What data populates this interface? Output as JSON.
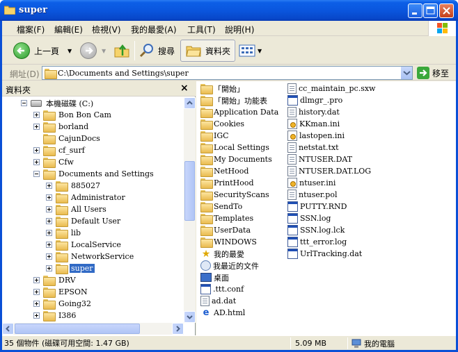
{
  "window": {
    "title": "super"
  },
  "menu": {
    "items": [
      "檔案(F)",
      "編輯(E)",
      "檢視(V)",
      "我的最愛(A)",
      "工具(T)",
      "說明(H)"
    ]
  },
  "toolbar": {
    "back_label": "上一頁",
    "search_label": "搜尋",
    "folders_label": "資料夾"
  },
  "address": {
    "label": "網址(D)",
    "value": "C:\\Documents and Settings\\super",
    "go_label": "移至"
  },
  "folder_pane": {
    "title": "資料夾",
    "close_glyph": "×",
    "tree": [
      {
        "label": "本機磁碟 (C:)",
        "level": 0,
        "expander": "minus",
        "icon": "drive"
      },
      {
        "label": "Bon Bon Cam",
        "level": 1,
        "expander": "plus",
        "icon": "folder"
      },
      {
        "label": "borland",
        "level": 1,
        "expander": "plus",
        "icon": "folder"
      },
      {
        "label": "CajunDocs",
        "level": 1,
        "expander": "none",
        "icon": "folder"
      },
      {
        "label": "cf_surf",
        "level": 1,
        "expander": "plus",
        "icon": "folder"
      },
      {
        "label": "Cfw",
        "level": 1,
        "expander": "plus",
        "icon": "folder"
      },
      {
        "label": "Documents and Settings",
        "level": 1,
        "expander": "minus",
        "icon": "folder"
      },
      {
        "label": "885027",
        "level": 2,
        "expander": "plus",
        "icon": "folder"
      },
      {
        "label": "Administrator",
        "level": 2,
        "expander": "plus",
        "icon": "folder"
      },
      {
        "label": "All Users",
        "level": 2,
        "expander": "plus",
        "icon": "folder"
      },
      {
        "label": "Default User",
        "level": 2,
        "expander": "plus",
        "icon": "folder"
      },
      {
        "label": "lib",
        "level": 2,
        "expander": "plus",
        "icon": "folder"
      },
      {
        "label": "LocalService",
        "level": 2,
        "expander": "plus",
        "icon": "folder"
      },
      {
        "label": "NetworkService",
        "level": 2,
        "expander": "plus",
        "icon": "folder"
      },
      {
        "label": "super",
        "level": 2,
        "expander": "plus",
        "icon": "folder",
        "selected": true
      },
      {
        "label": "DRV",
        "level": 1,
        "expander": "plus",
        "icon": "folder"
      },
      {
        "label": "EPSON",
        "level": 1,
        "expander": "plus",
        "icon": "folder"
      },
      {
        "label": "Going32",
        "level": 1,
        "expander": "plus",
        "icon": "folder"
      },
      {
        "label": "I386",
        "level": 1,
        "expander": "plus",
        "icon": "folder"
      }
    ]
  },
  "files": {
    "column1": [
      {
        "name": "「開始」",
        "icon": "folder"
      },
      {
        "name": "「開始」功能表",
        "icon": "folder"
      },
      {
        "name": "Application Data",
        "icon": "folder"
      },
      {
        "name": "Cookies",
        "icon": "folder"
      },
      {
        "name": "IGC",
        "icon": "folder"
      },
      {
        "name": "Local Settings",
        "icon": "folder"
      },
      {
        "name": "My Documents",
        "icon": "folder"
      },
      {
        "name": "NetHood",
        "icon": "folder"
      },
      {
        "name": "PrintHood",
        "icon": "folder"
      },
      {
        "name": "SecurityScans",
        "icon": "folder"
      },
      {
        "name": "SendTo",
        "icon": "folder"
      },
      {
        "name": "Templates",
        "icon": "folder"
      },
      {
        "name": "UserData",
        "icon": "folder"
      },
      {
        "name": "WINDOWS",
        "icon": "folder"
      },
      {
        "name": "我的最愛",
        "icon": "star"
      },
      {
        "name": "我最近的文件",
        "icon": "recent"
      },
      {
        "name": "桌面",
        "icon": "desktop"
      },
      {
        "name": ".ttt.conf",
        "icon": "win"
      },
      {
        "name": "ad.dat",
        "icon": "file"
      },
      {
        "name": "AD.html",
        "icon": "ie"
      }
    ],
    "column2": [
      {
        "name": "cc_maintain_pc.sxw",
        "icon": "file"
      },
      {
        "name": "dlmgr_.pro",
        "icon": "win"
      },
      {
        "name": "history.dat",
        "icon": "file"
      },
      {
        "name": "KKman.ini",
        "icon": "cfg"
      },
      {
        "name": "lastopen.ini",
        "icon": "cfg"
      },
      {
        "name": "netstat.txt",
        "icon": "file"
      },
      {
        "name": "NTUSER.DAT",
        "icon": "file"
      },
      {
        "name": "NTUSER.DAT.LOG",
        "icon": "file"
      },
      {
        "name": "ntuser.ini",
        "icon": "cfg"
      },
      {
        "name": "ntuser.pol",
        "icon": "file"
      },
      {
        "name": "PUTTY.RND",
        "icon": "win"
      },
      {
        "name": "SSN.log",
        "icon": "win"
      },
      {
        "name": "SSN.log.lck",
        "icon": "win"
      },
      {
        "name": "ttt_error.log",
        "icon": "win"
      },
      {
        "name": "UrlTracking.dat",
        "icon": "win"
      }
    ]
  },
  "status": {
    "objects": "35 個物件 (磁碟可用空間: 1.47 GB)",
    "size": "5.09 MB",
    "location": "我的電腦"
  },
  "colors": {
    "titlebar": "#0a56de",
    "selection": "#316ac5",
    "chrome": "#ece9d8"
  }
}
